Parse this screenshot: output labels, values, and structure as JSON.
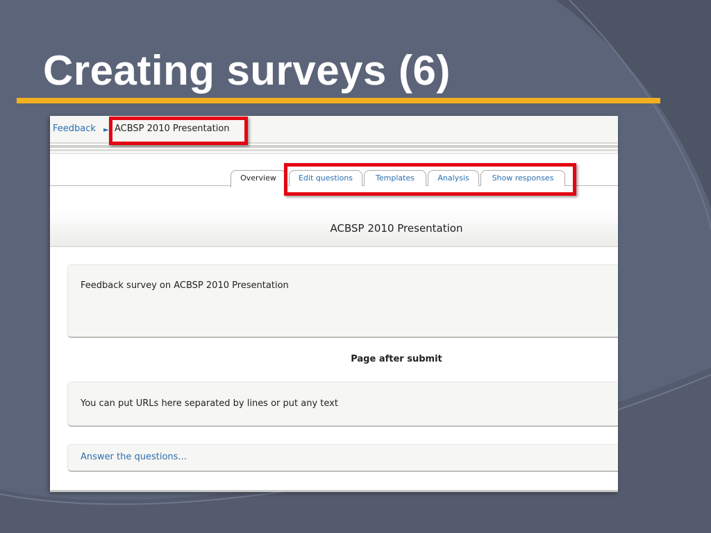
{
  "slide": {
    "title": "Creating surveys (6)",
    "accent_color": "#f2b01e",
    "highlight_color": "#e30613"
  },
  "breadcrumb": {
    "link": "Feedback",
    "separator": "►",
    "current": "ACBSP 2010 Presentation"
  },
  "tabs": [
    {
      "label": "Overview",
      "active": true
    },
    {
      "label": "Edit questions",
      "active": false
    },
    {
      "label": "Templates",
      "active": false
    },
    {
      "label": "Analysis",
      "active": false
    },
    {
      "label": "Show responses",
      "active": false
    }
  ],
  "main": {
    "heading": "ACBSP 2010 Presentation",
    "description": "Feedback survey on ACBSP 2010 Presentation",
    "page_after_submit_label": "Page after submit",
    "page_after_submit_text": "You can put URLs here separated by lines or put any text",
    "answer_link": "Answer the questions..."
  }
}
